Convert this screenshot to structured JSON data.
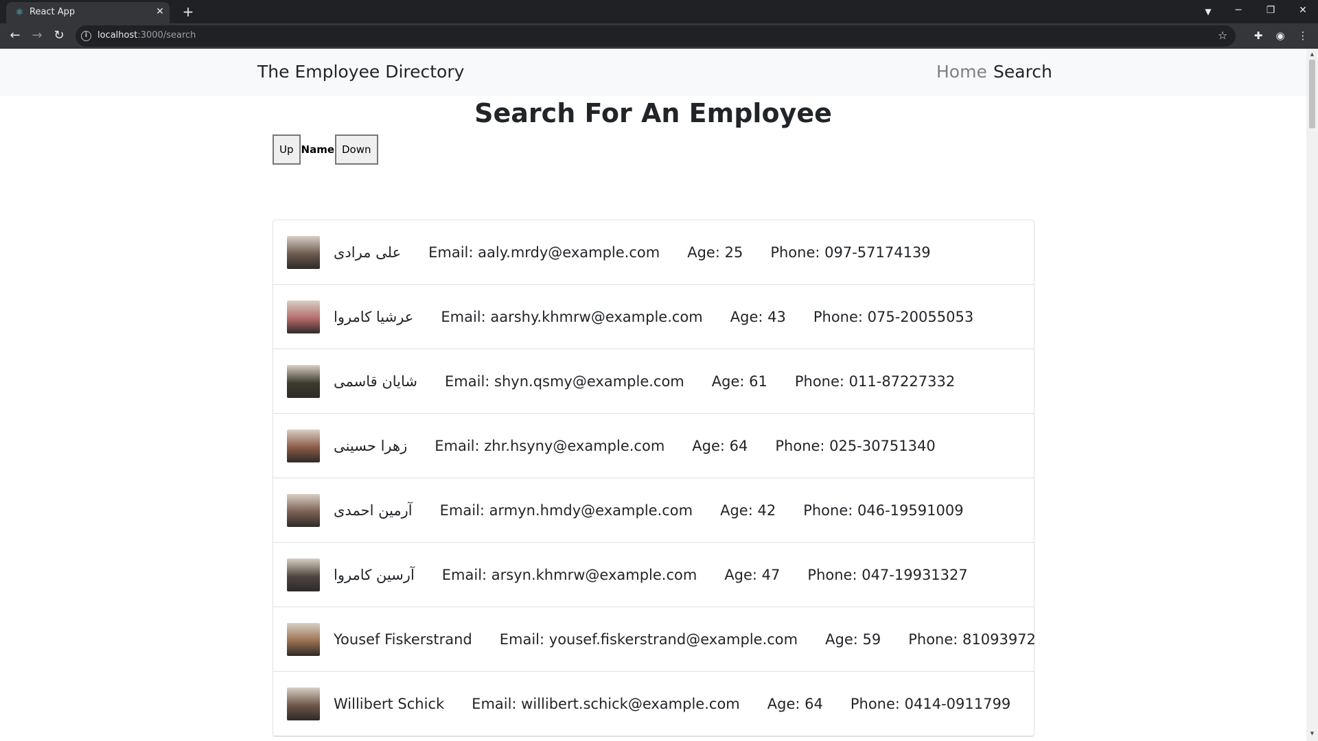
{
  "browser": {
    "tab_title": "React App",
    "url_host": "localhost",
    "url_path": ":3000/search"
  },
  "navbar": {
    "brand": "The Employee Directory",
    "links": [
      "Home",
      "Search"
    ]
  },
  "page": {
    "title": "Search For An Employee",
    "sort": {
      "up_label": "Up",
      "field_label": "Name",
      "down_label": "Down"
    }
  },
  "employees": [
    {
      "name": "علی مرادی",
      "email": "Email: aaly.mrdy@example.com",
      "age": "Age: 25",
      "phone": "Phone: 097-57174139",
      "avatar_color": "#6b5a4e"
    },
    {
      "name": "عرشیا کامروا",
      "email": "Email: aarshy.khmrw@example.com",
      "age": "Age: 43",
      "phone": "Phone: 075-20055053",
      "avatar_color": "#b56a6a"
    },
    {
      "name": "شایان قاسمی",
      "email": "Email: shyn.qsmy@example.com",
      "age": "Age: 61",
      "phone": "Phone: 011-87227332",
      "avatar_color": "#3d3a2e"
    },
    {
      "name": "زهرا حسینی",
      "email": "Email: zhr.hsyny@example.com",
      "age": "Age: 64",
      "phone": "Phone: 025-30751340",
      "avatar_color": "#8a5a46"
    },
    {
      "name": "آرمین احمدی",
      "email": "Email: armyn.hmdy@example.com",
      "age": "Age: 42",
      "phone": "Phone: 046-19591009",
      "avatar_color": "#7a5f52"
    },
    {
      "name": "آرسین کامروا",
      "email": "Email: arsyn.khmrw@example.com",
      "age": "Age: 47",
      "phone": "Phone: 047-19931327",
      "avatar_color": "#4e4540"
    },
    {
      "name": "Yousef Fiskerstrand",
      "email": "Email: yousef.fiskerstrand@example.com",
      "age": "Age: 59",
      "phone": "Phone: 81093972",
      "avatar_color": "#9a7050"
    },
    {
      "name": "Willibert Schick",
      "email": "Email: willibert.schick@example.com",
      "age": "Age: 64",
      "phone": "Phone: 0414-0911799",
      "avatar_color": "#6d5548"
    }
  ]
}
